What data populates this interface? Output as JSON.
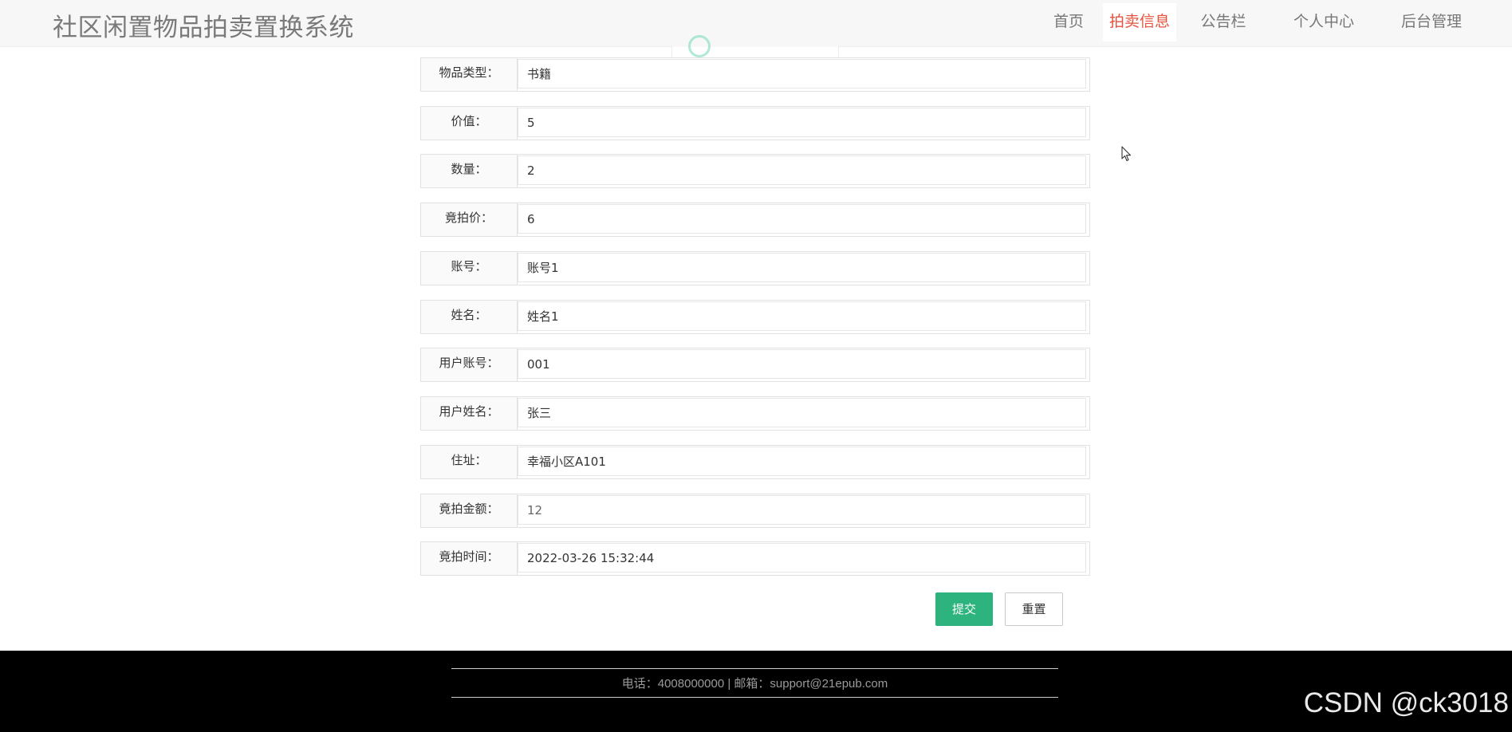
{
  "header": {
    "title": "社区闲置物品拍卖置换系统",
    "nav": [
      {
        "label": "首页",
        "active": false
      },
      {
        "label": "拍卖信息",
        "active": true
      },
      {
        "label": "公告栏",
        "active": false
      },
      {
        "label": "个人中心",
        "active": false
      },
      {
        "label": "后台管理",
        "active": false
      }
    ]
  },
  "form": {
    "fields": [
      {
        "label": "物品类型：",
        "value": "书籍"
      },
      {
        "label": "价值：",
        "value": "5"
      },
      {
        "label": "数量：",
        "value": "2"
      },
      {
        "label": "竟拍价：",
        "value": "6"
      },
      {
        "label": "账号：",
        "value": "账号1"
      },
      {
        "label": "姓名：",
        "value": "姓名1"
      },
      {
        "label": "用户账号：",
        "value": "001"
      },
      {
        "label": "用户姓名：",
        "value": "张三"
      },
      {
        "label": "住址：",
        "value": "幸福小区A101"
      },
      {
        "label": "竟拍金额：",
        "value": "12"
      },
      {
        "label": "竟拍时间：",
        "value": "2022-03-26 15:32:44"
      }
    ],
    "submit_label": "提交",
    "reset_label": "重置"
  },
  "footer": {
    "contact": "电话：4008000000 | 邮箱：support@21epub.com"
  },
  "watermark": "CSDN @ck3018",
  "colors": {
    "accent_nav": "#e5533d",
    "submit_button": "#2db37d",
    "footer_bg": "#000000"
  }
}
